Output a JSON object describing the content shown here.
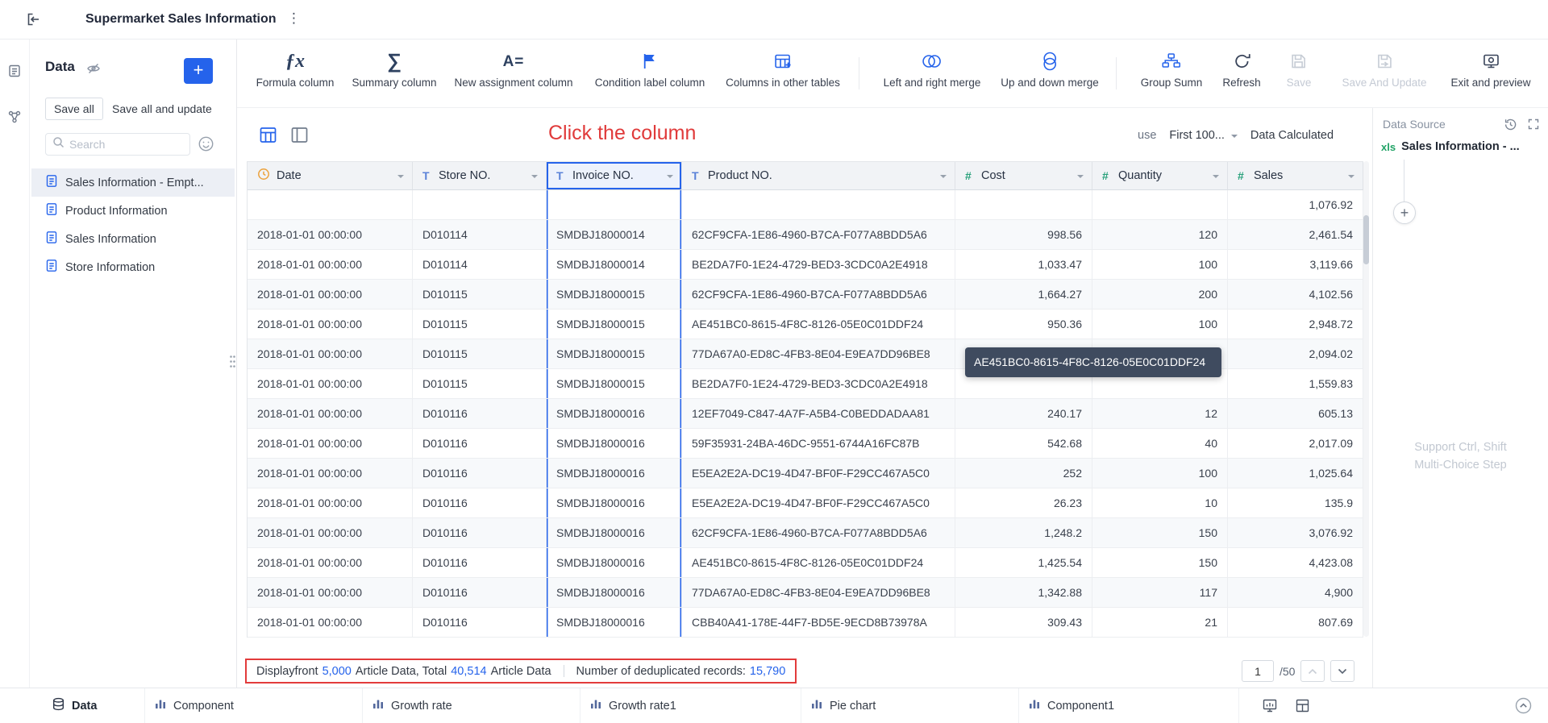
{
  "topbar": {
    "title": "Supermarket Sales Information"
  },
  "sidebar": {
    "heading": "Data",
    "save_all": "Save all",
    "save_all_update": "Save all and update",
    "search_placeholder": "Search",
    "tables": [
      {
        "label": "Sales Information - Empt..."
      },
      {
        "label": "Product Information"
      },
      {
        "label": "Sales Information"
      },
      {
        "label": "Store Information"
      }
    ]
  },
  "toolbar": {
    "items": [
      "Formula column",
      "Summary column",
      "New assignment column",
      "Condition label column",
      "Columns in other tables",
      "Left and right merge",
      "Up and down merge",
      "Group Sumn",
      "Refresh",
      "Save",
      "Save And Update",
      "Exit and preview"
    ]
  },
  "annotation": {
    "click_column": "Click the column"
  },
  "controls": {
    "use": "use",
    "limit": "First 100...",
    "status": "Data Calculated"
  },
  "table": {
    "columns": [
      {
        "label": "Date",
        "type": "date"
      },
      {
        "label": "Store NO.",
        "type": "text"
      },
      {
        "label": "Invoice NO.",
        "type": "text",
        "selected": true
      },
      {
        "label": "Product NO.",
        "type": "text"
      },
      {
        "label": "Cost",
        "type": "number"
      },
      {
        "label": "Quantity",
        "type": "number"
      },
      {
        "label": "Sales",
        "type": "number"
      }
    ],
    "rows": [
      [
        "",
        "",
        "",
        "",
        "",
        "",
        "1,076.92"
      ],
      [
        "2018-01-01 00:00:00",
        "D010114",
        "SMDBJ18000014",
        "62CF9CFA-1E86-4960-B7CA-F077A8BDD5A6",
        "998.56",
        "120",
        "2,461.54"
      ],
      [
        "2018-01-01 00:00:00",
        "D010114",
        "SMDBJ18000014",
        "BE2DA7F0-1E24-4729-BED3-3CDC0A2E4918",
        "1,033.47",
        "100",
        "3,119.66"
      ],
      [
        "2018-01-01 00:00:00",
        "D010115",
        "SMDBJ18000015",
        "62CF9CFA-1E86-4960-B7CA-F077A8BDD5A6",
        "1,664.27",
        "200",
        "4,102.56"
      ],
      [
        "2018-01-01 00:00:00",
        "D010115",
        "SMDBJ18000015",
        "AE451BC0-8615-4F8C-8126-05E0C01DDF24",
        "950.36",
        "100",
        "2,948.72"
      ],
      [
        "2018-01-01 00:00:00",
        "D010115",
        "SMDBJ18000015",
        "77DA67A0-ED8C-4FB3-8E04-E9EA7DD96BE8",
        "",
        "",
        "2,094.02"
      ],
      [
        "2018-01-01 00:00:00",
        "D010115",
        "SMDBJ18000015",
        "BE2DA7F0-1E24-4729-BED3-3CDC0A2E4918",
        "",
        "",
        "1,559.83"
      ],
      [
        "2018-01-01 00:00:00",
        "D010116",
        "SMDBJ18000016",
        "12EF7049-C847-4A7F-A5B4-C0BEDDADAA81",
        "240.17",
        "12",
        "605.13"
      ],
      [
        "2018-01-01 00:00:00",
        "D010116",
        "SMDBJ18000016",
        "59F35931-24BA-46DC-9551-6744A16FC87B",
        "542.68",
        "40",
        "2,017.09"
      ],
      [
        "2018-01-01 00:00:00",
        "D010116",
        "SMDBJ18000016",
        "E5EA2E2A-DC19-4D47-BF0F-F29CC467A5C0",
        "252",
        "100",
        "1,025.64"
      ],
      [
        "2018-01-01 00:00:00",
        "D010116",
        "SMDBJ18000016",
        "E5EA2E2A-DC19-4D47-BF0F-F29CC467A5C0",
        "26.23",
        "10",
        "135.9"
      ],
      [
        "2018-01-01 00:00:00",
        "D010116",
        "SMDBJ18000016",
        "62CF9CFA-1E86-4960-B7CA-F077A8BDD5A6",
        "1,248.2",
        "150",
        "3,076.92"
      ],
      [
        "2018-01-01 00:00:00",
        "D010116",
        "SMDBJ18000016",
        "AE451BC0-8615-4F8C-8126-05E0C01DDF24",
        "1,425.54",
        "150",
        "4,423.08"
      ],
      [
        "2018-01-01 00:00:00",
        "D010116",
        "SMDBJ18000016",
        "77DA67A0-ED8C-4FB3-8E04-E9EA7DD96BE8",
        "1,342.88",
        "117",
        "4,900"
      ],
      [
        "2018-01-01 00:00:00",
        "D010116",
        "SMDBJ18000016",
        "CBB40A41-178E-44F7-BD5E-9ECD8B73978A",
        "309.43",
        "21",
        "807.69"
      ]
    ]
  },
  "tooltip": {
    "text": "AE451BC0-8615-4F8C-8126-05E0C01DDF24"
  },
  "statusbar": {
    "display_label": "Displayfront",
    "display_count": "5,000",
    "total_label": "Article Data, Total",
    "total_count": "40,514",
    "total_suffix": "Article Data",
    "dedup_label": "Number of deduplicated records:",
    "dedup_count": "15,790"
  },
  "pager": {
    "page": "1",
    "total": "/50"
  },
  "data_source": {
    "title": "Data Source",
    "badge": "xls",
    "name": "Sales Information - ...",
    "hint1": "Support Ctrl, Shift",
    "hint2": "Multi-Choice Step"
  },
  "tabbar": {
    "tabs": [
      {
        "label": "Data"
      },
      {
        "label": "Component"
      },
      {
        "label": "Growth rate"
      },
      {
        "label": "Growth rate1"
      },
      {
        "label": "Pie chart"
      },
      {
        "label": "Component1"
      }
    ]
  }
}
